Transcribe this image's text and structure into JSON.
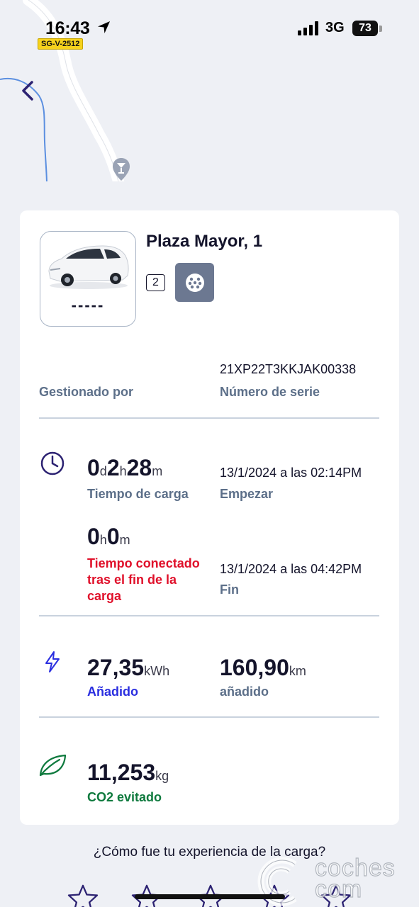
{
  "status_bar": {
    "time": "16:43",
    "road_badge": "SG-V-2512",
    "network": "3G",
    "battery": "73"
  },
  "station": {
    "name": "Plaza Mayor, 1",
    "plate": "-----",
    "connector_count": "2"
  },
  "info": {
    "managed_label": "Gestionado por",
    "serial_value": "21XP22T3KKJAK00338",
    "serial_label": "Número de serie"
  },
  "charge_time": {
    "d": "0",
    "d_unit": "d",
    "h": "2",
    "h_unit": "h",
    "m": "28",
    "m_unit": "m",
    "label": "Tiempo de carga",
    "start_value": "13/1/2024 a las 02:14PM",
    "start_label": "Empezar"
  },
  "connected_after": {
    "h": "0",
    "h_unit": "h",
    "m": "0",
    "m_unit": "m",
    "label": "Tiempo conectado tras el fin de la carga",
    "end_value": "13/1/2024 a las 04:42PM",
    "end_label": "Fin"
  },
  "energy": {
    "value": "27,35",
    "unit": "kWh",
    "label": "Añadido",
    "km_value": "160,90",
    "km_unit": "km",
    "km_label": "añadido"
  },
  "co2": {
    "value": "11,253",
    "unit": "kg",
    "label": "CO2 evitado"
  },
  "feedback": {
    "question": "¿Cómo fue tu experiencia de la carga?",
    "rating": 0,
    "max_rating": 5
  },
  "watermark": {
    "line1": "coches",
    "line2": "com"
  },
  "icons": {
    "back": "chevron-left-icon",
    "clock": "clock-icon",
    "bolt": "lightning-icon",
    "leaf": "leaf-icon",
    "connector": "ev-plug-icon",
    "star": "star-outline-icon"
  },
  "colors": {
    "accent": "#2a2ee0",
    "error": "#e0102a",
    "success": "#0f7a3e",
    "icon_purple": "#2c2272",
    "muted_label": "#5c6f89"
  }
}
